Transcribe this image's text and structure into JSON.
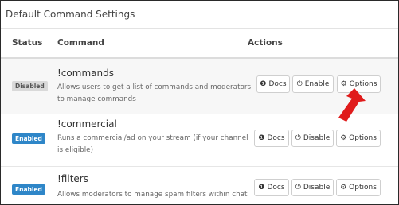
{
  "panel": {
    "title": "Default Command Settings"
  },
  "columns": {
    "status": "Status",
    "command": "Command",
    "actions": "Actions"
  },
  "commands": [
    {
      "status": "Disabled",
      "name": "!commands",
      "description": "Allows users to get a list of commands and moderators to manage commands",
      "buttons": {
        "docs": "Docs",
        "toggle": "Enable",
        "options": "Options"
      }
    },
    {
      "status": "Enabled",
      "name": "!commercial",
      "description": "Runs a commercial/ad on your stream (if your channel is eligible)",
      "buttons": {
        "docs": "Docs",
        "toggle": "Disable",
        "options": "Options"
      }
    },
    {
      "status": "Enabled",
      "name": "!filters",
      "description": "Allows moderators to manage spam filters within chat",
      "buttons": {
        "docs": "Docs",
        "toggle": "Disable",
        "options": "Options"
      }
    }
  ],
  "icons": {
    "docs": "info-circle-icon",
    "toggle": "power-icon",
    "options": "gears-icon",
    "annotation": "red-arrow-icon"
  },
  "colors": {
    "enabled_badge": "#2e86c8",
    "disabled_badge": "#d9d9d9",
    "arrow": "#e01b1b"
  }
}
